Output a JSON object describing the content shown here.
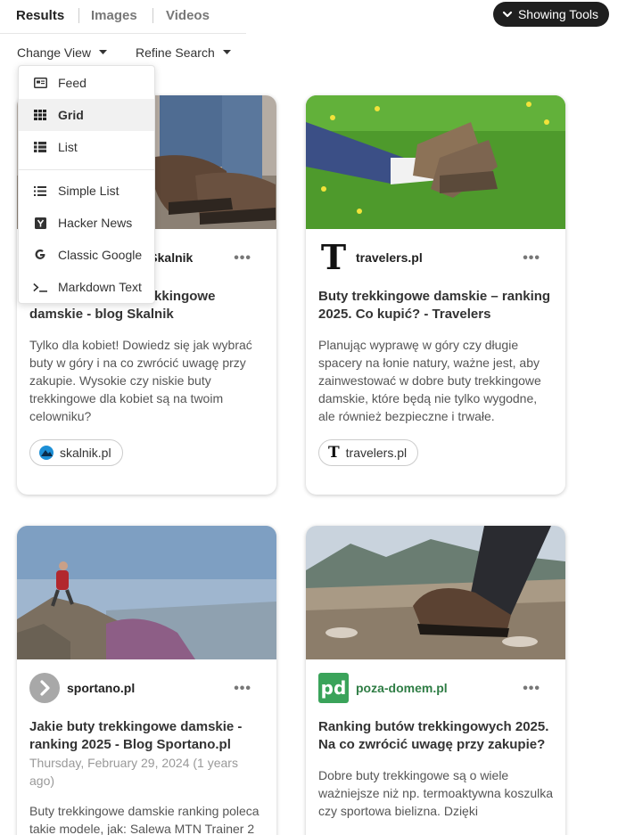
{
  "tabs": [
    {
      "label": "Results",
      "active": true
    },
    {
      "label": "Images",
      "active": false
    },
    {
      "label": "Videos",
      "active": false
    }
  ],
  "tools_button": {
    "label": "Showing Tools",
    "icon": "chevron-down-icon"
  },
  "sub_bar": {
    "change_view": "Change View",
    "refine_search": "Refine Search"
  },
  "view_menu": {
    "items": [
      {
        "label": "Feed",
        "icon": "feed-icon",
        "selected": false
      },
      {
        "label": "Grid",
        "icon": "grid-icon",
        "selected": true
      },
      {
        "label": "List",
        "icon": "list-icon",
        "selected": false
      },
      {
        "label": "Simple List",
        "icon": "simple-list-icon",
        "selected": false
      },
      {
        "label": "Hacker News",
        "icon": "hacker-news-icon",
        "selected": false
      },
      {
        "label": "Classic Google",
        "icon": "google-icon",
        "selected": false
      },
      {
        "label": "Markdown Text",
        "icon": "terminal-icon",
        "selected": false
      }
    ]
  },
  "cards": [
    {
      "source": "Blog, porady, Skalnik",
      "title": "Jak wybrać buty trekkingowe damskie - blog Skalnik",
      "snippet": "Tylko dla kobiet! Dowiedz się jak wybrać buty w góry i na co zwrócić uwagę przy zakupie. Wysokie czy niskie buty trekkingowe dla kobiet są na twoim celowniku?",
      "chip": "skalnik.pl"
    },
    {
      "source": "travelers.pl",
      "title": "Buty trekkingowe damskie – ranking 2025. Co kupić? - Travelers",
      "snippet": "Planując wyprawę w góry czy długie spacery na łonie natury, ważne jest, aby zainwestować w dobre buty trekkingowe damskie, które będą nie tylko wygodne, ale również bezpieczne i trwałe.",
      "chip": "travelers.pl",
      "logo_letter": "T"
    },
    {
      "source": "sportano.pl",
      "title": "Jakie buty trekkingowe damskie - ranking 2025 - Blog Sportano.pl",
      "date": "Thursday, February 29, 2024 (1 years ago)",
      "snippet": "Buty trekkingowe damskie ranking poleca takie modele, jak: Salewa MTN Trainer 2"
    },
    {
      "source": "poza-domem.pl",
      "title": "Ranking butów trekkingowych 2025. Na co zwrócić uwagę przy zakupie?",
      "snippet": "Dobre buty trekkingowe są o wiele ważniejsze niż np. termoaktywna koszulka czy sportowa bielizna. Dzięki",
      "logo_text": "pd"
    }
  ],
  "more_label": "•••",
  "colors": {
    "tools_bg": "#1f1f1f",
    "poza_domem_green": "#3aa35a",
    "sportano_gray": "#a8a8a8",
    "skalnik_blue": "#1c8fd6"
  }
}
